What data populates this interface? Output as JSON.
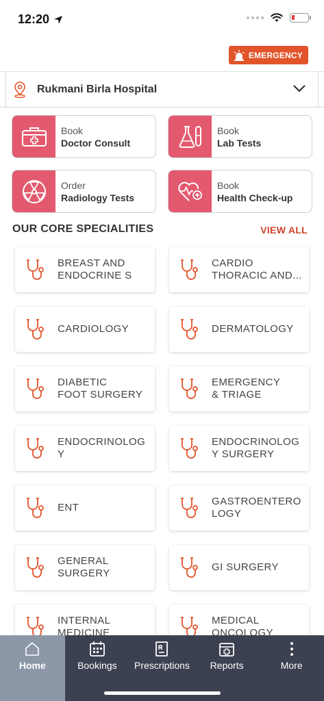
{
  "status": {
    "time": "12:20"
  },
  "header": {
    "emergency_label": "EMERGENCY"
  },
  "hospital": {
    "name": "Rukmani Birla Hospital"
  },
  "actions": [
    {
      "small": "Book",
      "big": "Doctor Consult"
    },
    {
      "small": "Book",
      "big": "Lab Tests"
    },
    {
      "small": "Order",
      "big": "Radiology Tests"
    },
    {
      "small": "Book",
      "big": "Health Check-up"
    }
  ],
  "specialities": {
    "title": "OUR CORE SPECIALITIES",
    "view_all": "VIEW ALL",
    "items": [
      "BREAST AND\nENDOCRINE SU...",
      "CARDIO\nTHORACIC AND...",
      "CARDIOLOGY",
      "DERMATOLOGY",
      "DIABETIC\nFOOT SURGERY",
      "EMERGENCY\n& TRIAGE",
      "ENDOCRINOLOG\nY",
      "ENDOCRINOLOG\nY SURGERY",
      "ENT",
      "GASTROENTERO\nLOGY",
      "GENERAL\nSURGERY",
      "GI SURGERY",
      "INTERNAL\nMEDICINE",
      "MEDICAL\nONCOLOGY"
    ]
  },
  "nav": [
    {
      "label": "Home",
      "icon": "home-icon"
    },
    {
      "label": "Bookings",
      "icon": "calendar-icon"
    },
    {
      "label": "Prescriptions",
      "icon": "prescription-icon"
    },
    {
      "label": "Reports",
      "icon": "report-icon"
    },
    {
      "label": "More",
      "icon": "more-icon"
    }
  ],
  "colors": {
    "accent": "#e35a6f",
    "emergency": "#e2542a",
    "view_all": "#d2452a",
    "nav_bg": "#3c4151",
    "nav_active": "#8c97a8"
  }
}
